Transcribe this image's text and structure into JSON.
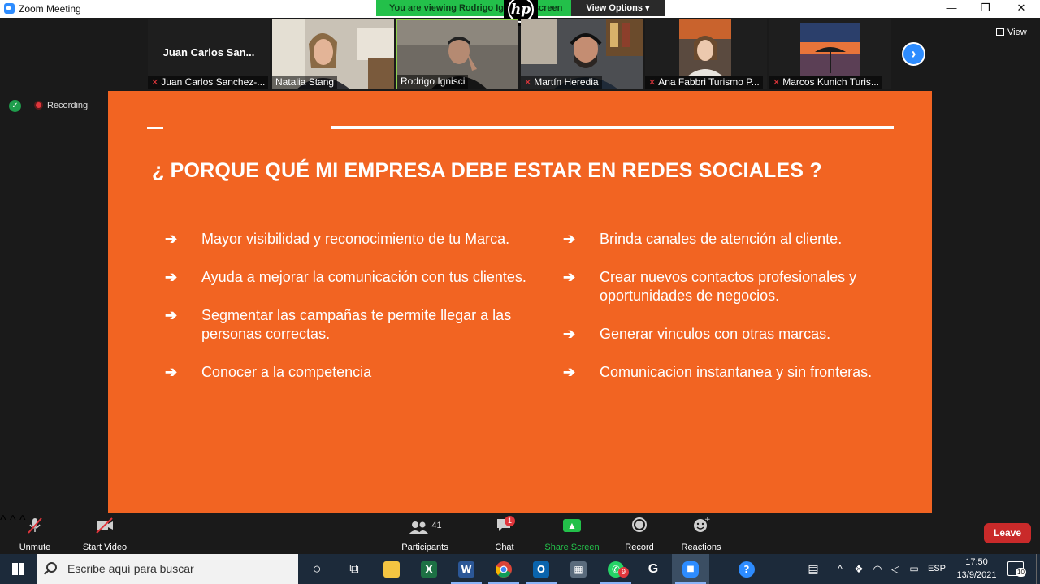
{
  "window": {
    "title": "Zoom Meeting",
    "minimize": "—",
    "restore": "❐",
    "close": "✕"
  },
  "share_banner": {
    "viewing_text": "You are viewing Rodrigo Ignisci's screen",
    "view_options": "View Options ▾",
    "logo_text": "hp"
  },
  "participants_strip": [
    {
      "name": "Juan Carlos Sanchez-...",
      "big_name": "Juan Carlos San...",
      "muted": true
    },
    {
      "name": "Natalia Stang",
      "muted": false
    },
    {
      "name": "Rodrigo Ignisci",
      "muted": false,
      "active": true
    },
    {
      "name": "Martín Heredia",
      "muted": true
    },
    {
      "name": "Ana Fabbri Turismo P...",
      "muted": true
    },
    {
      "name": "Marcos Kunich Turis...",
      "muted": true
    }
  ],
  "strip_next": "›",
  "view_button": "View",
  "recording": "Recording",
  "slide": {
    "heading": "¿ PORQUE  QUÉ MI EMPRESA DEBE ESTAR EN REDES SOCIALES ?",
    "arrow": "➔",
    "left_items": [
      {
        "text": "Mayor visibilidad y reconocimiento de tu Marca."
      },
      {
        "text": "Ayuda a mejorar la comunicación con tus clientes."
      },
      {
        "text": "Segmentar las campañas  te permite llegar  a las personas correctas."
      },
      {
        "text": "Conocer a la competencia"
      }
    ],
    "right_items": [
      {
        "text": "Brinda canales de atención al cliente."
      },
      {
        "text": "Crear nuevos contactos profesionales y oportunidades de negocios."
      },
      {
        "text": "Generar vinculos con otras marcas."
      },
      {
        "text": "Comunicacion instantanea y sin fronteras."
      }
    ]
  },
  "controls": {
    "unmute": "Unmute",
    "start_video": "Start Video",
    "participants": "Participants",
    "participants_count": "41",
    "chat": "Chat",
    "chat_badge": "1",
    "share_screen": "Share Screen",
    "record": "Record",
    "reactions": "Reactions",
    "leave": "Leave",
    "caret": "^"
  },
  "taskbar": {
    "search_placeholder": "Escribe aquí para buscar",
    "whatsapp_badge": "9",
    "language": "ESP",
    "time": "17:50",
    "date": "13/9/2021",
    "notifications": "10",
    "apps": [
      {
        "name": "cortana-icon",
        "glyph": "○"
      },
      {
        "name": "task-view-icon",
        "glyph": "⧉"
      },
      {
        "name": "file-explorer-icon",
        "glyph": "▬",
        "color": "#f4c542"
      },
      {
        "name": "excel-icon",
        "glyph": "X",
        "color": "#1d7044"
      },
      {
        "name": "word-icon",
        "glyph": "W",
        "color": "#2b5797"
      },
      {
        "name": "chrome-icon",
        "glyph": "●",
        "color": "#db4437"
      },
      {
        "name": "outlook-icon",
        "glyph": "O",
        "color": "#0a64ad"
      },
      {
        "name": "calculator-icon",
        "glyph": "▦",
        "color": "#5a6b7c"
      },
      {
        "name": "whatsapp-icon",
        "glyph": "✆",
        "color": "#25d366"
      },
      {
        "name": "app-icon",
        "glyph": "G",
        "color": "#1c2a3a"
      },
      {
        "name": "zoom-icon",
        "glyph": "■",
        "color": "#2d8cff"
      },
      {
        "name": "help-icon",
        "glyph": "?",
        "color": "#2d8cff"
      }
    ]
  }
}
